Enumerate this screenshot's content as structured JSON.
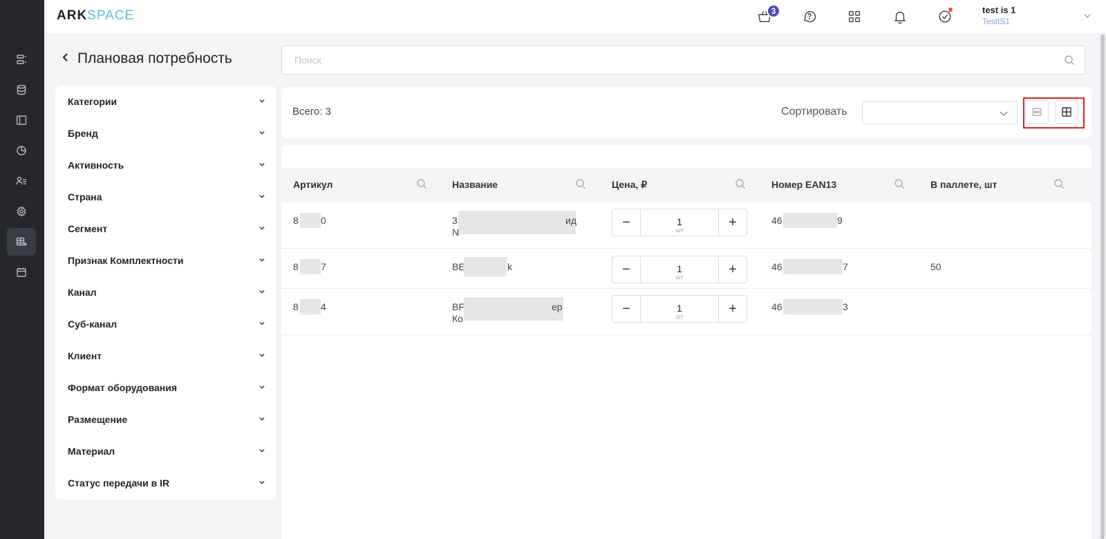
{
  "app": {
    "logo_part1": "ARK",
    "logo_part2": "SPACE"
  },
  "rail": {
    "items": [
      {
        "icon": "list-icon"
      },
      {
        "icon": "database-icon"
      },
      {
        "icon": "sidebar-layout-icon"
      },
      {
        "icon": "pie-chart-icon"
      },
      {
        "icon": "users-icon"
      },
      {
        "icon": "gear-icon"
      },
      {
        "icon": "table-add-icon",
        "active": true
      },
      {
        "icon": "calendar-icon"
      }
    ]
  },
  "header": {
    "cart_count": "3",
    "user": {
      "name": "test is 1",
      "org": "TestIS1"
    }
  },
  "page": {
    "title": "Плановая потребность"
  },
  "search": {
    "placeholder": "Поиск"
  },
  "filters": [
    "Категории",
    "Бренд",
    "Активность",
    "Страна",
    "Сегмент",
    "Признак Комплектности",
    "Канал",
    "Суб-канал",
    "Клиент",
    "Формат оборудования",
    "Размещение",
    "Материал",
    "Статус передачи в IR"
  ],
  "toolbar": {
    "total": "Всего: 3",
    "sort_label": "Сортировать",
    "sort_value": ""
  },
  "table": {
    "columns": [
      "Артикул",
      "Название",
      "Цена, ₽",
      "Номер EAN13",
      "В паллете, шт"
    ],
    "rows": [
      {
        "article_start": "8",
        "article_end": "0",
        "name_start": "3",
        "name_end": "ид",
        "name_line2_start": "N",
        "qty": "1",
        "unit": "шт",
        "ean_start": "46",
        "ean_end": "9",
        "pallet": ""
      },
      {
        "article_start": "8",
        "article_end": "7",
        "name_start": "BE",
        "name_end": "k",
        "name_line2_start": "",
        "qty": "1",
        "unit": "шт",
        "ean_start": "46",
        "ean_end": "7",
        "pallet": "50"
      },
      {
        "article_start": "8",
        "article_end": "4",
        "name_start": "BF",
        "name_end": "ер",
        "name_line2_start": "Ко",
        "qty": "1",
        "unit": "шт",
        "ean_start": "46",
        "ean_end": "3",
        "pallet": ""
      }
    ]
  }
}
